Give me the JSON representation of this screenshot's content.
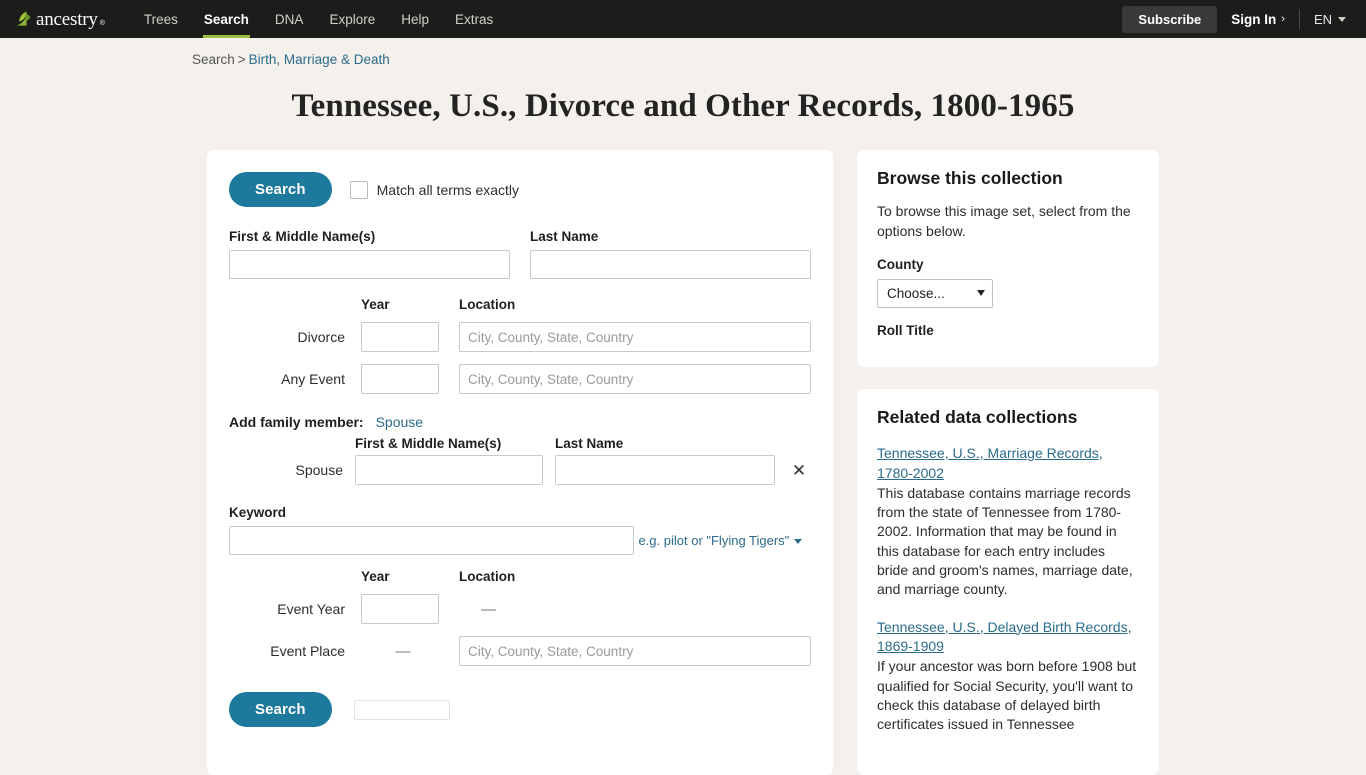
{
  "header": {
    "logo_text": "ancestry",
    "logo_tm": "®",
    "nav": [
      {
        "label": "Trees",
        "active": false
      },
      {
        "label": "Search",
        "active": true
      },
      {
        "label": "DNA",
        "active": false
      },
      {
        "label": "Explore",
        "active": false
      },
      {
        "label": "Help",
        "active": false
      },
      {
        "label": "Extras",
        "active": false
      }
    ],
    "subscribe_label": "Subscribe",
    "signin_label": "Sign In",
    "signin_chevron": "›",
    "language_label": "EN"
  },
  "breadcrumb": {
    "root": "Search",
    "separator": ">",
    "current": "Birth, Marriage & Death"
  },
  "page_title": "Tennessee, U.S., Divorce and Other Records, 1800-1965",
  "form": {
    "search_button": "Search",
    "match_exact_label": "Match all terms exactly",
    "first_name_label": "First & Middle Name(s)",
    "first_name_value": "",
    "last_name_label": "Last Name",
    "last_name_value": "",
    "year_header": "Year",
    "location_header": "Location",
    "location_placeholder": "City, County, State, Country",
    "divorce_label": "Divorce",
    "divorce_year_value": "",
    "divorce_location_value": "",
    "any_event_label": "Any Event",
    "any_event_year_value": "",
    "any_event_location_value": "",
    "add_family_label": "Add family member:",
    "add_family_link": "Spouse",
    "spouse_first_header": "First & Middle Name(s)",
    "spouse_last_header": "Last Name",
    "spouse_row_label": "Spouse",
    "spouse_first_value": "",
    "spouse_last_value": "",
    "spouse_remove_icon": "✕",
    "keyword_label": "Keyword",
    "keyword_value": "",
    "keyword_hint": "e.g. pilot or \"Flying Tigers\"",
    "event_year_label": "Event Year",
    "event_year_value": "",
    "event_year_location_dash": "—",
    "event_place_label": "Event Place",
    "event_place_year_dash": "—",
    "event_place_value": "",
    "bottom_search_button": "Search"
  },
  "browse": {
    "title": "Browse this collection",
    "description": "To browse this image set, select from the options below.",
    "county_label": "County",
    "county_selected": "Choose...",
    "roll_title_label": "Roll Title"
  },
  "related": {
    "title": "Related data collections",
    "items": [
      {
        "link": "Tennessee, U.S., Marriage Records, 1780-2002",
        "description": "This database contains marriage records from the state of Tennessee from 1780-2002. Information that may be found in this database for each entry includes bride and groom's names, marriage date, and marriage county."
      },
      {
        "link": "Tennessee, U.S., Delayed Birth Records, 1869-1909",
        "description": "If your ancestor was born before 1908 but qualified for Social Security, you'll want to check this database of delayed birth certificates issued in Tennessee"
      }
    ]
  },
  "colors": {
    "nav_background": "#1c1c1a",
    "nav_active_underline": "#9bbb3c",
    "accent_button": "#1d7a9c",
    "link": "#2d6b8a",
    "page_background": "#f4f1ec"
  }
}
